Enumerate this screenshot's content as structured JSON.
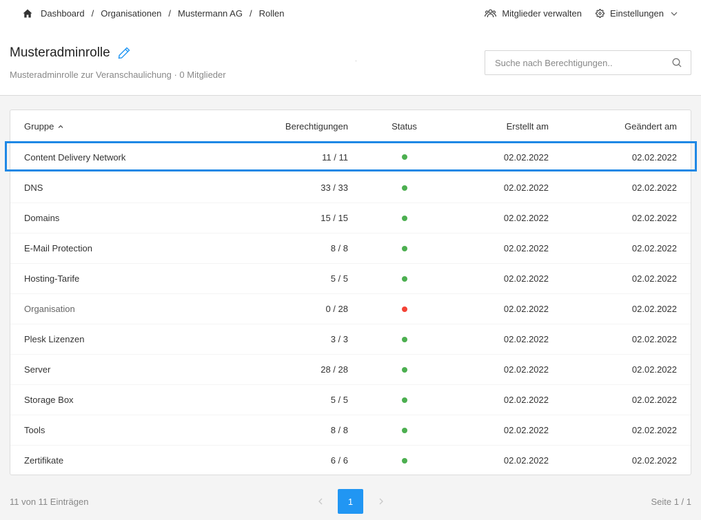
{
  "breadcrumb": [
    "Dashboard",
    "Organisationen",
    "Mustermann AG",
    "Rollen"
  ],
  "breadcrumb_sep": "/",
  "actions": {
    "members": "Mitglieder verwalten",
    "settings": "Einstellungen"
  },
  "role": {
    "title": "Musteradminrolle",
    "subtitle": "Musteradminrolle zur Veranschaulichung · 0 Mitglieder"
  },
  "search": {
    "placeholder": "Suche nach Berechtigungen.."
  },
  "table": {
    "headers": {
      "group": "Gruppe",
      "permissions": "Berechtigungen",
      "status": "Status",
      "created": "Erstellt am",
      "changed": "Geändert am"
    },
    "rows": [
      {
        "group": "Content Delivery Network",
        "permissions": "11 / 11",
        "status": "active",
        "created": "02.02.2022",
        "changed": "02.02.2022"
      },
      {
        "group": "DNS",
        "permissions": "33 / 33",
        "status": "active",
        "created": "02.02.2022",
        "changed": "02.02.2022"
      },
      {
        "group": "Domains",
        "permissions": "15 / 15",
        "status": "active",
        "created": "02.02.2022",
        "changed": "02.02.2022"
      },
      {
        "group": "E-Mail Protection",
        "permissions": "8 / 8",
        "status": "active",
        "created": "02.02.2022",
        "changed": "02.02.2022"
      },
      {
        "group": "Hosting-Tarife",
        "permissions": "5 / 5",
        "status": "active",
        "created": "02.02.2022",
        "changed": "02.02.2022"
      },
      {
        "group": "Organisation",
        "permissions": "0 / 28",
        "status": "inactive",
        "created": "02.02.2022",
        "changed": "02.02.2022"
      },
      {
        "group": "Plesk Lizenzen",
        "permissions": "3 / 3",
        "status": "active",
        "created": "02.02.2022",
        "changed": "02.02.2022"
      },
      {
        "group": "Server",
        "permissions": "28 / 28",
        "status": "active",
        "created": "02.02.2022",
        "changed": "02.02.2022"
      },
      {
        "group": "Storage Box",
        "permissions": "5 / 5",
        "status": "active",
        "created": "02.02.2022",
        "changed": "02.02.2022"
      },
      {
        "group": "Tools",
        "permissions": "8 / 8",
        "status": "active",
        "created": "02.02.2022",
        "changed": "02.02.2022"
      },
      {
        "group": "Zertifikate",
        "permissions": "6 / 6",
        "status": "active",
        "created": "02.02.2022",
        "changed": "02.02.2022"
      }
    ]
  },
  "footer": {
    "count": "11 von 11 Einträgen",
    "page": "1",
    "pageinfo": "Seite 1 / 1"
  },
  "colors": {
    "accent": "#2196f3",
    "active": "#4caf50",
    "inactive": "#f44336",
    "highlight": "#1e88e5"
  },
  "icons": {
    "home": "home-icon",
    "members": "users-icon",
    "settings": "gear-icon",
    "edit": "pencil-icon",
    "search": "search-icon",
    "sort": "chevron-up-icon"
  }
}
